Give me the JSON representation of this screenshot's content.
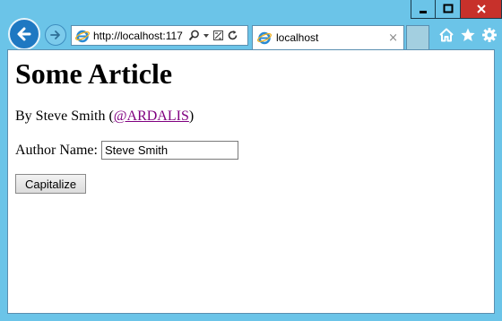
{
  "browser": {
    "address_url": "http://localhost:117",
    "tab_title": "localhost",
    "tab_close": "×"
  },
  "icons": {
    "back": "back-arrow-icon",
    "forward": "forward-arrow-icon",
    "page": "ie-logo-icon",
    "search": "search-icon",
    "dropdown": "dropdown-arrow-icon",
    "compat": "compatibility-view-icon",
    "refresh": "refresh-icon",
    "home": "home-icon",
    "favorites": "star-icon",
    "tools": "gear-icon",
    "minimize": "minimize-icon",
    "maximize": "maximize-icon",
    "close": "close-icon"
  },
  "colors": {
    "chrome": "#6bc4e8",
    "close_button": "#c7312b",
    "link": "#800080"
  },
  "page": {
    "heading": "Some Article",
    "byline_prefix": "By Steve Smith (",
    "byline_link": "@ARDALIS",
    "byline_suffix": ")",
    "author_label": "Author Name:",
    "author_value": "Steve Smith",
    "button_label": "Capitalize"
  }
}
